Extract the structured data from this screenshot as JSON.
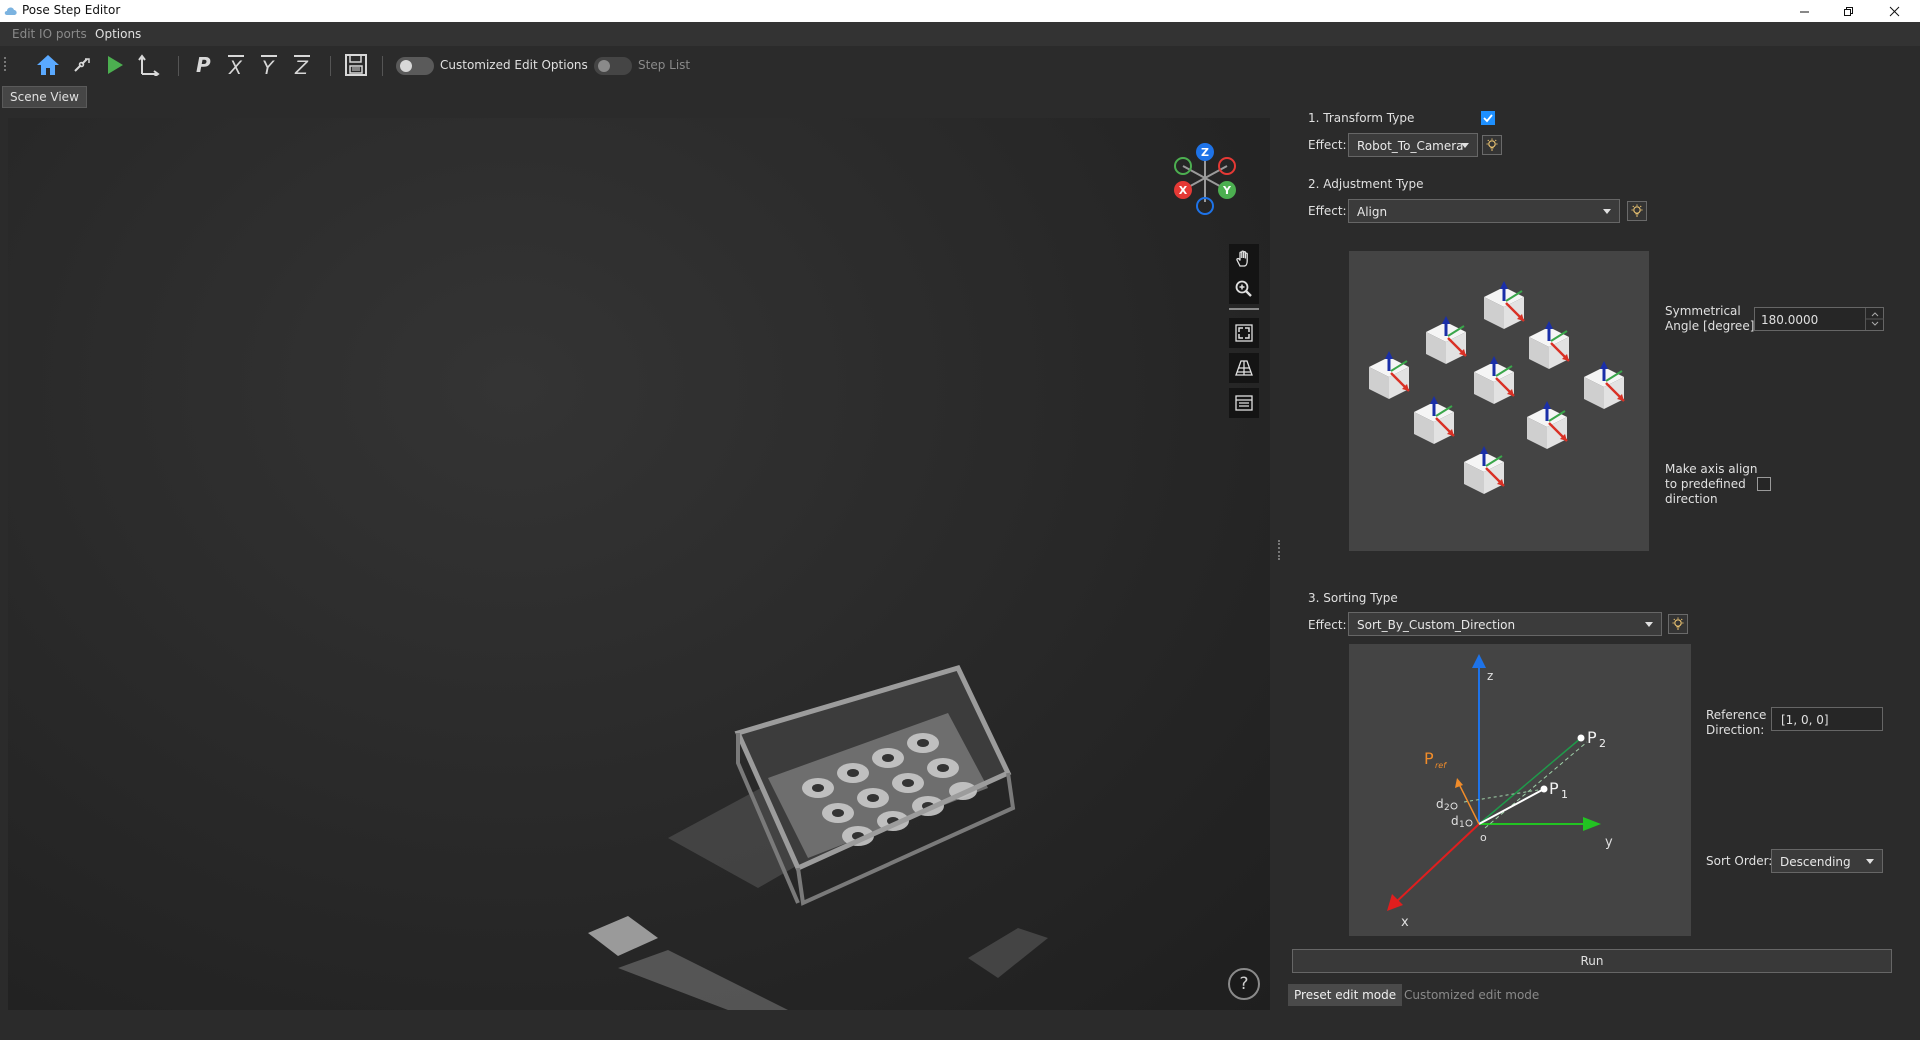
{
  "window": {
    "title": "Pose Step Editor"
  },
  "menu": {
    "items": [
      "Edit IO ports",
      "Options"
    ]
  },
  "toolbar": {
    "toggle_custom_label": "Customized Edit Options",
    "toggle_steplist_label": "Step List",
    "icons": [
      "grip-icon",
      "home-icon",
      "pick-point-icon",
      "run-icon",
      "axis-icon",
      "p-tool-icon",
      "x-tool-icon",
      "y-tool-icon",
      "z-tool-icon",
      "save-icon"
    ]
  },
  "scene": {
    "tab_label": "Scene View",
    "gizmo": {
      "z": "Z",
      "x": "X",
      "y": "Y"
    },
    "help_label": "?"
  },
  "panel": {
    "transform": {
      "title": "1. Transform Type",
      "effect_label": "Effect:",
      "effect_value": "Robot_To_Camera",
      "checked": true
    },
    "adjustment": {
      "title": "2. Adjustment Type",
      "effect_label": "Effect:",
      "effect_value": "Align",
      "sym_label_1": "Symmetrical",
      "sym_label_2": "Angle [degree]:",
      "sym_value": "180.0000",
      "align_label_1": "Make axis align",
      "align_label_2": "to predefined",
      "align_label_3": "direction",
      "align_checked": false
    },
    "sorting": {
      "title": "3. Sorting Type",
      "effect_label": "Effect:",
      "effect_value": "Sort_By_Custom_Direction",
      "ref_label_1": "Reference",
      "ref_label_2": "Direction:",
      "ref_value": "[1, 0, 0]",
      "order_label": "Sort Order:",
      "order_value": "Descending",
      "diagram": {
        "z": "z",
        "y": "y",
        "x": "x",
        "o": "o",
        "p2": "P",
        "p2_sub": "2",
        "p1": "P",
        "p1_sub": "1",
        "pref": "P",
        "pref_sub": "ref",
        "d2": "d",
        "d2_sub": "2",
        "d1": "d",
        "d1_sub": "1"
      }
    },
    "run_label": "Run",
    "mode_tabs": [
      "Preset edit mode",
      "Customized edit mode"
    ]
  },
  "colors": {
    "accent": "#1e90ff",
    "run_green": "#4caf50",
    "bulb": "#e8c170"
  }
}
